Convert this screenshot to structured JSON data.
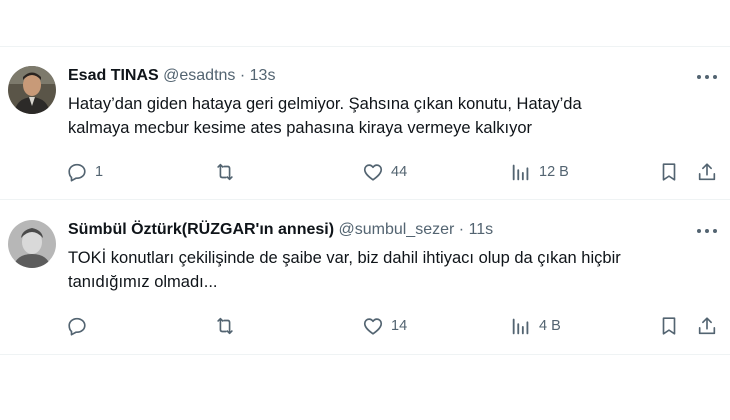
{
  "tweets": [
    {
      "author_name": "Esad TINAS",
      "handle": "@esadtns",
      "separator": "·",
      "time": "13s",
      "text_line1": "Hatay’dan giden hataya geri gelmiyor. Şahsına çıkan konutu, Hatay’da",
      "text_line2": "kalmaya mecbur kesime ates pahasına kiraya vermeye kalkıyor",
      "replies": "1",
      "retweets": "",
      "likes": "44",
      "views": "12 B"
    },
    {
      "author_name": "Sümbül Öztürk(RÜZGAR'ın annesi)",
      "handle": "@sumbul_sezer",
      "separator": "·",
      "time": "11s",
      "text_line1": "TOKİ konutları çekilişinde de şaibe var, biz dahil ihtiyacı olup da çıkan hiçbir",
      "text_line2": "tanıdığımız olmadı...",
      "replies": "",
      "retweets": "",
      "likes": "14",
      "views": "4 B"
    }
  ],
  "icons": {
    "reply": "reply-icon",
    "retweet": "retweet-icon",
    "like": "heart-icon",
    "views": "views-icon",
    "bookmark": "bookmark-icon",
    "share": "share-icon",
    "more": "more-icon"
  },
  "colors": {
    "text": "#0f1419",
    "secondary": "#536471",
    "divider": "#eff3f4"
  }
}
